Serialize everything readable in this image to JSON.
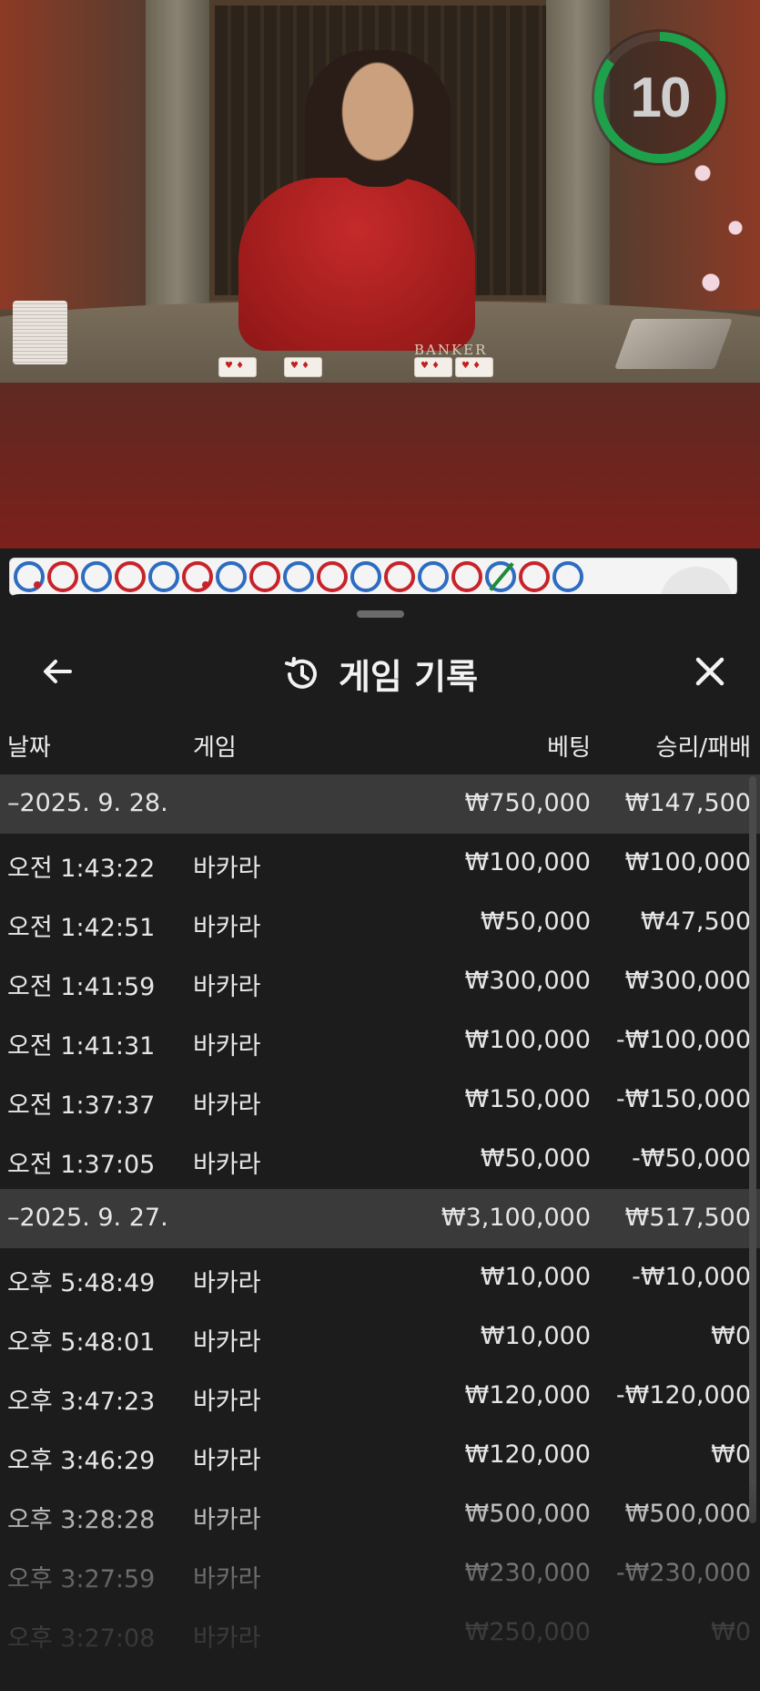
{
  "video": {
    "table_label": "BANKER",
    "countdown": "10",
    "countdown_progress": 0.85
  },
  "road": {
    "results": [
      {
        "side": "P",
        "tie": false,
        "pair": true
      },
      {
        "side": "B",
        "tie": false,
        "pair": false
      },
      {
        "side": "P",
        "tie": false,
        "pair": false
      },
      {
        "side": "B",
        "tie": false,
        "pair": false
      },
      {
        "side": "P",
        "tie": false,
        "pair": false
      },
      {
        "side": "B",
        "tie": false,
        "pair": true
      },
      {
        "side": "P",
        "tie": false,
        "pair": false
      },
      {
        "side": "B",
        "tie": false,
        "pair": false
      },
      {
        "side": "P",
        "tie": false,
        "pair": false
      },
      {
        "side": "B",
        "tie": false,
        "pair": false
      },
      {
        "side": "P",
        "tie": false,
        "pair": false
      },
      {
        "side": "B",
        "tie": false,
        "pair": false
      },
      {
        "side": "P",
        "tie": false,
        "pair": false
      },
      {
        "side": "B",
        "tie": false,
        "pair": false
      },
      {
        "side": "P",
        "tie": true,
        "pair": false
      },
      {
        "side": "B",
        "tie": false,
        "pair": false
      },
      {
        "side": "P",
        "tie": false,
        "pair": false
      }
    ]
  },
  "panel": {
    "title": "게임 기록",
    "icons": {
      "back": "arrow-left-icon",
      "history": "history-icon",
      "close": "close-icon"
    },
    "columns": {
      "date": "날짜",
      "game": "게임",
      "bet": "베팅",
      "result": "승리/패배"
    },
    "rows": [
      {
        "type": "group",
        "date": "–2025. 9. 28.",
        "game": "",
        "bet": "₩750,000",
        "result": "₩147,500"
      },
      {
        "type": "item",
        "date": "오전 1:43:22",
        "game": "바카라",
        "bet": "₩100,000",
        "result": "₩100,000"
      },
      {
        "type": "item",
        "date": "오전 1:42:51",
        "game": "바카라",
        "bet": "₩50,000",
        "result": "₩47,500"
      },
      {
        "type": "item",
        "date": "오전 1:41:59",
        "game": "바카라",
        "bet": "₩300,000",
        "result": "₩300,000"
      },
      {
        "type": "item",
        "date": "오전 1:41:31",
        "game": "바카라",
        "bet": "₩100,000",
        "result": "-₩100,000"
      },
      {
        "type": "item",
        "date": "오전 1:37:37",
        "game": "바카라",
        "bet": "₩150,000",
        "result": "-₩150,000"
      },
      {
        "type": "item",
        "date": "오전 1:37:05",
        "game": "바카라",
        "bet": "₩50,000",
        "result": "-₩50,000"
      },
      {
        "type": "group",
        "date": "–2025. 9. 27.",
        "game": "",
        "bet": "₩3,100,000",
        "result": "₩517,500"
      },
      {
        "type": "item",
        "date": "오후 5:48:49",
        "game": "바카라",
        "bet": "₩10,000",
        "result": "-₩10,000"
      },
      {
        "type": "item",
        "date": "오후 5:48:01",
        "game": "바카라",
        "bet": "₩10,000",
        "result": "₩0"
      },
      {
        "type": "item",
        "date": "오후 3:47:23",
        "game": "바카라",
        "bet": "₩120,000",
        "result": "-₩120,000"
      },
      {
        "type": "item",
        "date": "오후 3:46:29",
        "game": "바카라",
        "bet": "₩120,000",
        "result": "₩0"
      },
      {
        "type": "item",
        "date": "오후 3:28:28",
        "game": "바카라",
        "bet": "₩500,000",
        "result": "₩500,000"
      },
      {
        "type": "item",
        "date": "오후 3:27:59",
        "game": "바카라",
        "bet": "₩230,000",
        "result": "-₩230,000"
      },
      {
        "type": "item",
        "date": "오후 3:27:08",
        "game": "바카라",
        "bet": "₩250,000",
        "result": "₩0"
      }
    ]
  }
}
